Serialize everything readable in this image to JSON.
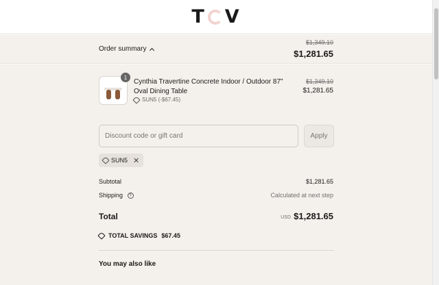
{
  "header": {
    "logo_left": "T",
    "logo_right": "V"
  },
  "summary": {
    "toggle_label": "Order summary",
    "original_total": "$1,349.10",
    "total": "$1,281.65"
  },
  "product": {
    "name": "Cynthia Travertine Concrete Indoor / Outdoor 87\" Oval Dining Table",
    "quantity": "1",
    "discount": "SUN5 (-$67.45)",
    "original_price": "$1,349.10",
    "price": "$1,281.65"
  },
  "discount_field": {
    "placeholder": "Discount code or gift card",
    "apply_label": "Apply"
  },
  "applied_code": "SUN5",
  "totals": {
    "subtotal_label": "Subtotal",
    "subtotal_value": "$1,281.65",
    "shipping_label": "Shipping",
    "shipping_value": "Calculated at next step",
    "shipping_help": "?",
    "total_label": "Total",
    "currency": "USD",
    "total_value": "$1,281.65"
  },
  "savings": {
    "label": "TOTAL SAVINGS",
    "amount": "$67.45"
  },
  "also_like": "You may also like",
  "colors": {
    "background": "#f4f0eb",
    "logo_accent": "#f2d3cf",
    "text": "#1a1a1a"
  }
}
